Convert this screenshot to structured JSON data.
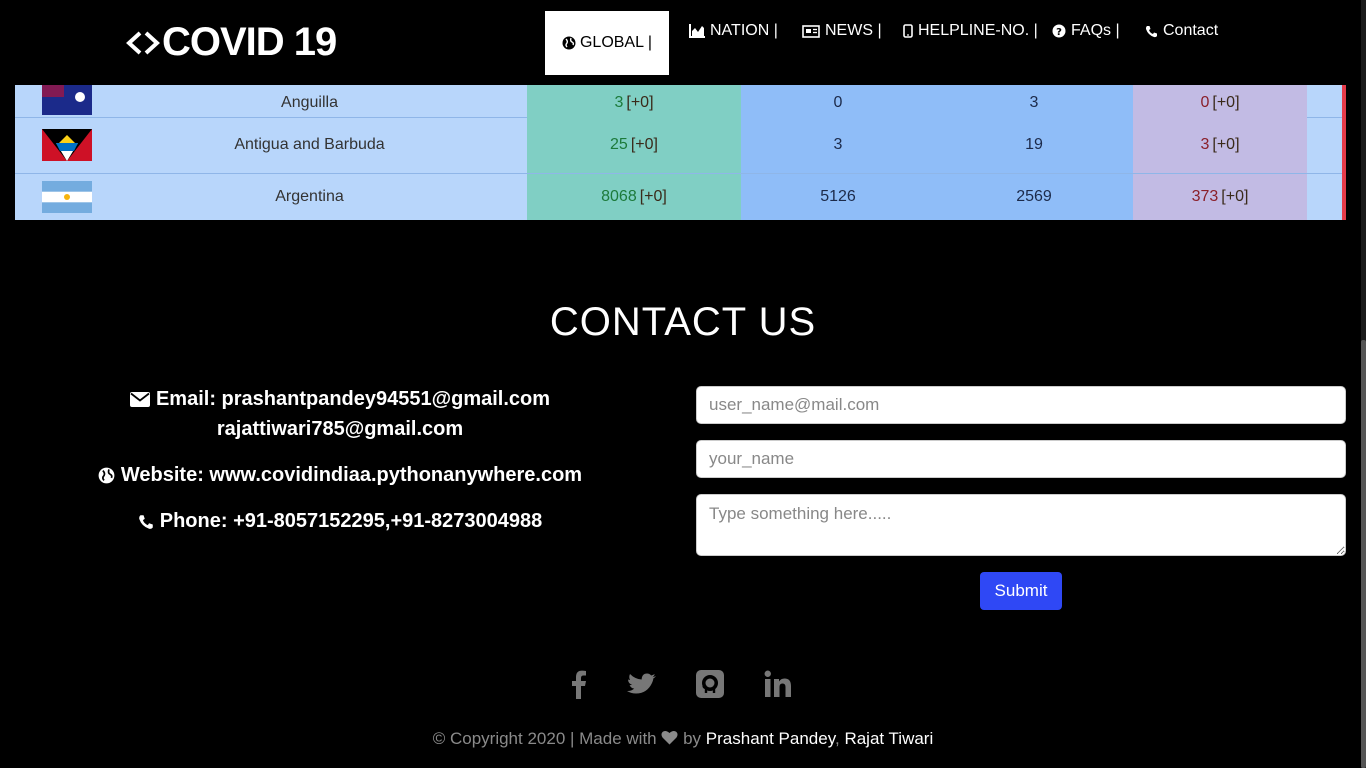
{
  "navbar": {
    "brand": "COVID 19",
    "items": [
      {
        "label": "GLOBAL |",
        "icon": "globe-icon",
        "active": true
      },
      {
        "label": "NATION |",
        "icon": "chart-icon"
      },
      {
        "label": "NEWS |",
        "icon": "newspaper-icon"
      },
      {
        "label": "HELPLINE-NO. |",
        "icon": "mobile-icon"
      },
      {
        "label": "FAQs |",
        "icon": "question-icon"
      },
      {
        "label": "Contact",
        "icon": "phone-icon"
      }
    ]
  },
  "table": {
    "rows": [
      {
        "country": "Anguilla",
        "confirmed": "3",
        "confirmed_delta": "[+0]",
        "active": "0",
        "recovered": "3",
        "deaths": "0",
        "deaths_delta": "[+0]"
      },
      {
        "country": "Antigua and Barbuda",
        "confirmed": "25",
        "confirmed_delta": "[+0]",
        "active": "3",
        "recovered": "19",
        "deaths": "3",
        "deaths_delta": "[+0]"
      },
      {
        "country": "Argentina",
        "confirmed": "8068",
        "confirmed_delta": "[+0]",
        "active": "5126",
        "recovered": "2569",
        "deaths": "373",
        "deaths_delta": "[+0]"
      }
    ]
  },
  "contact": {
    "title": "CONTACT US",
    "email_line1": "Email: prashantpandey94551@gmail.com",
    "email_line2": "rajattiwari785@gmail.com",
    "website": "Website: www.covidindiaa.pythonanywhere.com",
    "phone": "Phone: +91-8057152295,+91-8273004988"
  },
  "form": {
    "email_placeholder": "user_name@mail.com",
    "name_placeholder": "your_name",
    "message_placeholder": "Type something here.....",
    "submit_label": "Submit"
  },
  "footer": {
    "prefix": "© Copyright 2020 | Made with",
    "by": "by",
    "author1": "Prashant Pandey",
    "separator": ",",
    "author2": "Rajat Tiwari"
  },
  "colors": {
    "accent": "#2f48f5",
    "confirmed_bg": "#80cfc4",
    "active_bg": "#8fbdf8",
    "deaths_bg": "#c2bbe4",
    "row_bg": "#b8d6fb",
    "border_red": "#e53b4a"
  }
}
